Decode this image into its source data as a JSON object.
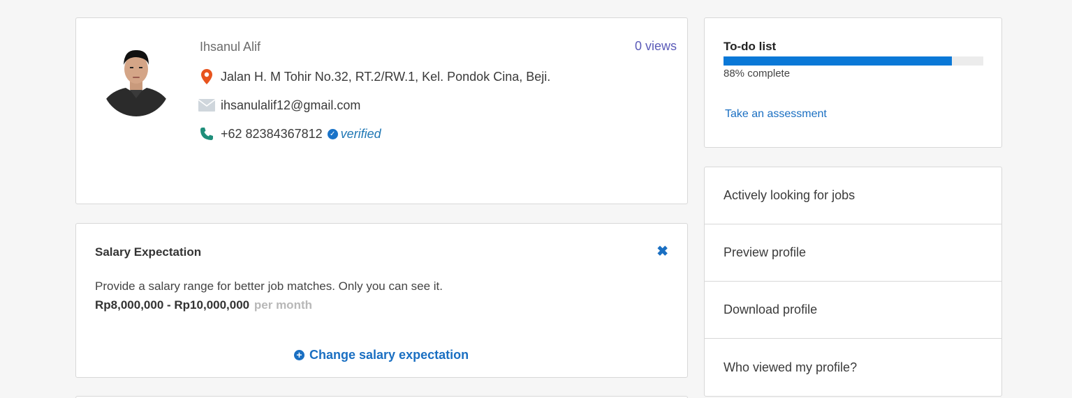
{
  "profile": {
    "name": "Ihsanul Alif",
    "views": "0 views",
    "address": "Jalan H. M Tohir No.32, RT.2/RW.1, Kel. Pondok Cina, Beji.",
    "email": "ihsanulalif12@gmail.com",
    "phone": "+62 82384367812",
    "verified": "verified",
    "icons": [
      "location-pin-icon",
      "envelope-icon",
      "phone-icon",
      "check-circle-icon"
    ],
    "colors": {
      "pin": "#e8541e",
      "envelope": "#cfd6dc",
      "phone": "#1e8e7a",
      "verified": "#1a73c8"
    }
  },
  "salary": {
    "title": "Salary Expectation",
    "description": "Provide a salary range for better job matches. Only you can see it.",
    "range": "Rp8,000,000 - Rp10,000,000",
    "period": "per month",
    "change_label": "Change salary expectation"
  },
  "todo": {
    "title": "To-do list",
    "progress_percent": 88,
    "progress_label": "88% complete",
    "assessment_link": "Take an assessment"
  },
  "menu": {
    "items": [
      {
        "label": "Actively looking for jobs"
      },
      {
        "label": "Preview profile"
      },
      {
        "label": "Download profile"
      },
      {
        "label": "Who viewed my profile?"
      }
    ]
  },
  "colors": {
    "accent": "#1a6fc2",
    "progress": "#0a78d7",
    "views": "#5b5bb8"
  }
}
